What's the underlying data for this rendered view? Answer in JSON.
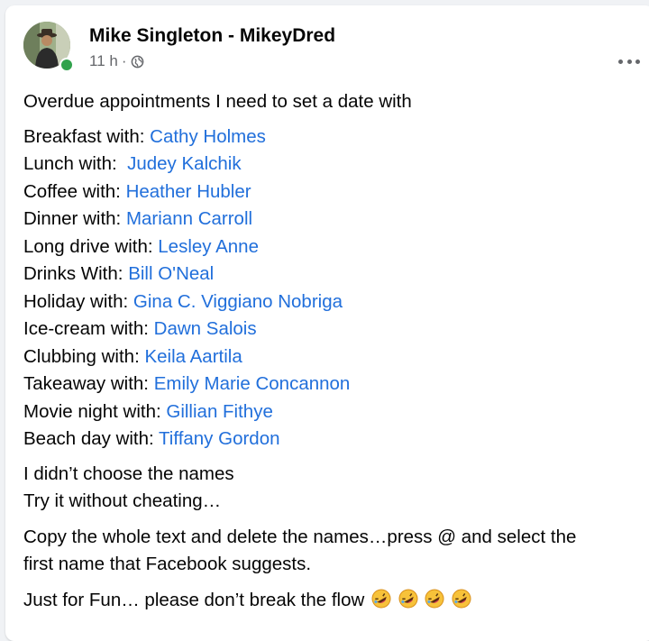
{
  "post": {
    "author": "Mike Singleton - MikeyDred",
    "time": "11 h",
    "separator": "·",
    "privacy_icon": "globe-icon",
    "more_icon": "more-options-icon",
    "intro": "Overdue appointments I need to set a date with",
    "appointments": [
      {
        "label": "Breakfast with: ",
        "name": "Cathy Holmes"
      },
      {
        "label": "Lunch with:  ",
        "name": "Judey Kalchik"
      },
      {
        "label": "Coffee with: ",
        "name": "Heather Hubler"
      },
      {
        "label": "Dinner with: ",
        "name": "Mariann Carroll"
      },
      {
        "label": "Long drive with: ",
        "name": "Lesley Anne"
      },
      {
        "label": "Drinks With: ",
        "name": "Bill O'Neal"
      },
      {
        "label": "Holiday with: ",
        "name": "Gina C. Viggiano Nobriga"
      },
      {
        "label": "Ice-cream with: ",
        "name": "Dawn Salois"
      },
      {
        "label": "Clubbing with: ",
        "name": "Keila Aartila"
      },
      {
        "label": "Takeaway with: ",
        "name": "Emily Marie Concannon"
      },
      {
        "label": "Movie night with: ",
        "name": "Gillian Fithye"
      },
      {
        "label": "Beach day with: ",
        "name": "Tiffany Gordon"
      }
    ],
    "note_line1": "I didn’t choose the names",
    "note_line2": "Try it without cheating…",
    "instructions_line1": "Copy the whole text and delete the names…press @ and select the",
    "instructions_line2": "first name that Facebook suggests.",
    "closing": "Just for Fun… please don’t break the flow",
    "closing_emoji_icon": "rolling-on-floor-laughing-emoji-icon",
    "closing_emoji_count": 4
  },
  "colors": {
    "mention": "#216fdb",
    "online": "#31a24c",
    "meta": "#65676b",
    "background": "#f0f2f5"
  }
}
